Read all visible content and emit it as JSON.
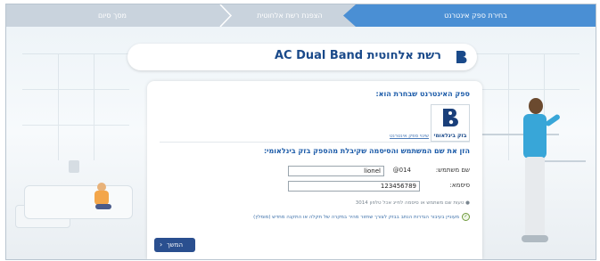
{
  "steps": [
    {
      "label": "בחירת ספק אינטרנט",
      "active": true
    },
    {
      "label": "הצפנת רשת אלחוטית",
      "active": false
    },
    {
      "label": "מסך סיום",
      "active": false
    }
  ],
  "banner": {
    "title": "רשת אלחוטית AC Dual Band",
    "logo_icon": "bezeq-logo-icon"
  },
  "provider": {
    "title": "ספק האינטרנט שבחרת הוא:",
    "name": "בזק בינלאומי",
    "change_link": "שינוי ספק אינטרנט"
  },
  "form": {
    "instruction": "הזן את שם המשתמש והסיסמה שקיבלת מהספק בזק בינלאומי:",
    "username_label": "שם משתמש:",
    "username_value": "lionel",
    "domain_suffix": "@014",
    "password_label": "סיסמא:",
    "password_value": "123456789",
    "note": "● טעות שם משתמש או סיסמה לחייג אכל טלפון 3014",
    "checkbox_label": "מעוניין בעיבור הגדרות הנתב בבזק לצורך שחזור מהיר במקרה של תקלה או התקנה מחדש (מומלץ)",
    "checkbox_checked": true
  },
  "actions": {
    "next_label": "המשך"
  },
  "colors": {
    "accent": "#4a8fd4",
    "step_inactive": "#c9d3dd",
    "brand_blue": "#1a4a8a",
    "button": "#2a4f8f"
  }
}
